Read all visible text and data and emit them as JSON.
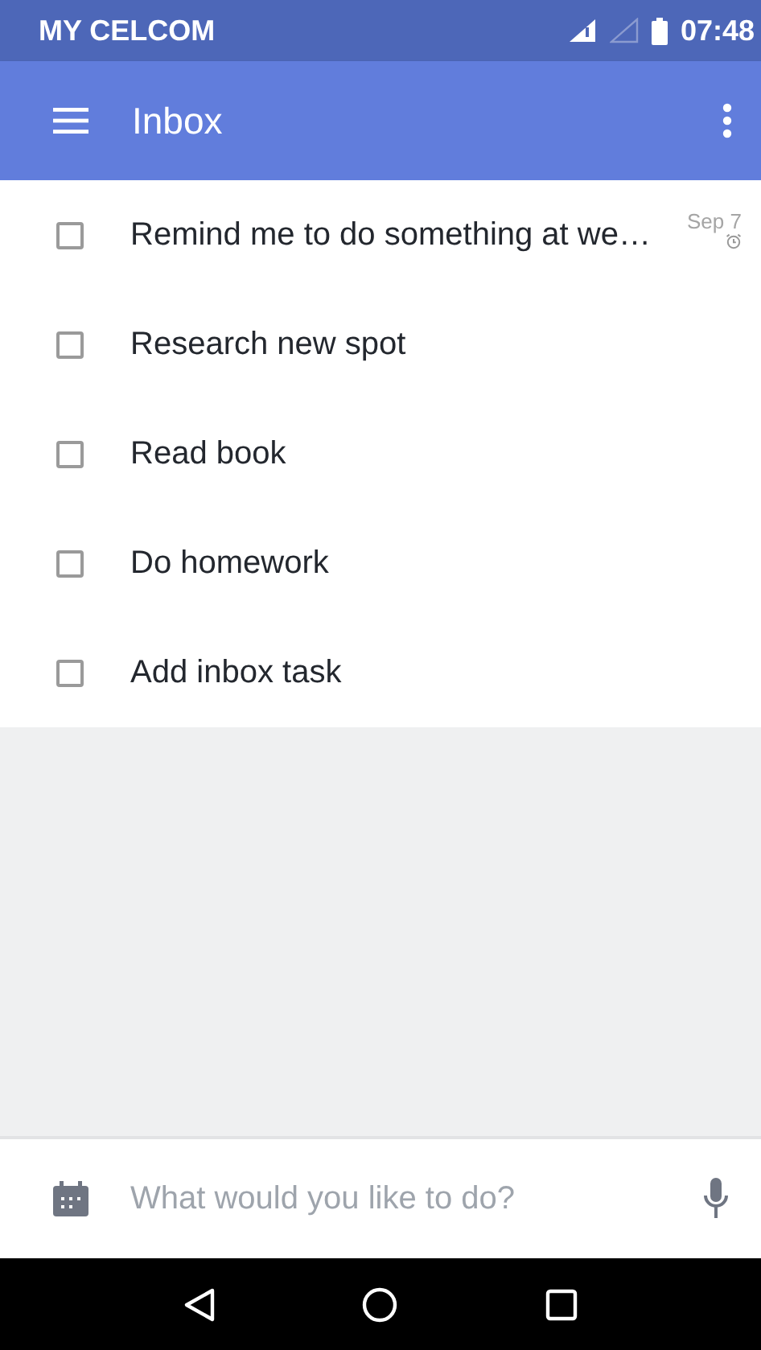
{
  "status_bar": {
    "carrier": "MY CELCOM",
    "time": "07:48"
  },
  "app_bar": {
    "title": "Inbox"
  },
  "tasks": [
    {
      "title": "Remind me to do something at we…",
      "checked": false,
      "date": "Sep 7",
      "reminder": true
    },
    {
      "title": "Research new spot",
      "checked": false,
      "reminder": false
    },
    {
      "title": "Read book",
      "checked": false,
      "reminder": false
    },
    {
      "title": "Do homework",
      "checked": false,
      "reminder": false
    },
    {
      "title": "Add inbox task",
      "checked": false,
      "reminder": false
    }
  ],
  "quick_add": {
    "placeholder": "What would you like to do?"
  }
}
